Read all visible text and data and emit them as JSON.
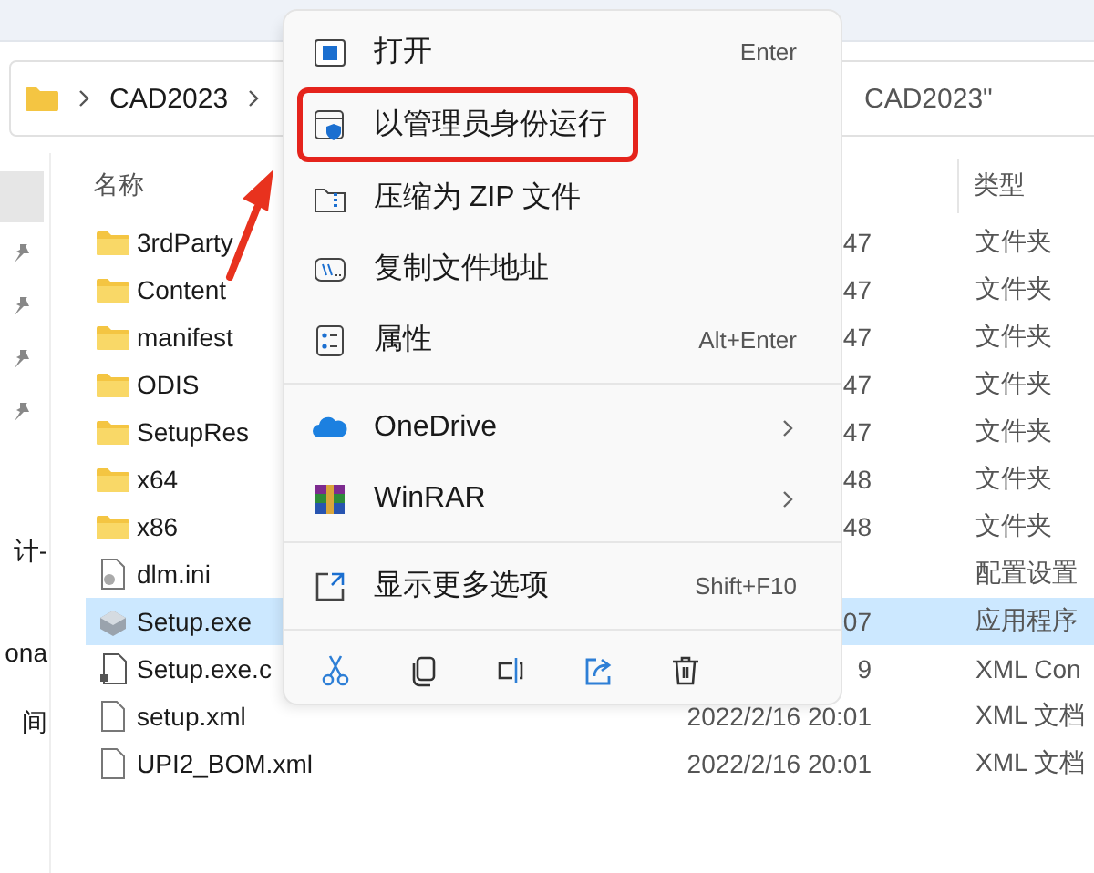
{
  "address_bar": {
    "path": [
      "CAD2023"
    ]
  },
  "search": {
    "value": "CAD2023\""
  },
  "nav_pane": {
    "items": [
      {
        "kind": "entry",
        "selected": true
      },
      {
        "kind": "pinned",
        "selected": false
      },
      {
        "kind": "pinned",
        "selected": false
      },
      {
        "kind": "pinned",
        "selected": false
      },
      {
        "kind": "pinned",
        "selected": false
      },
      {
        "kind": "label",
        "label": "计-",
        "selected": false
      },
      {
        "kind": "label",
        "label": "ona",
        "selected": false
      },
      {
        "kind": "label",
        "label": "间",
        "selected": false
      }
    ]
  },
  "file_list": {
    "columns": [
      "名称",
      "类型"
    ],
    "rows": [
      {
        "kind": "folder",
        "name": "3rdParty",
        "date": "47",
        "type": "文件夹",
        "selected": false
      },
      {
        "kind": "folder",
        "name": "Content",
        "date": "47",
        "type": "文件夹",
        "selected": false
      },
      {
        "kind": "folder",
        "name": "manifest",
        "date": "47",
        "type": "文件夹",
        "selected": false
      },
      {
        "kind": "folder",
        "name": "ODIS",
        "date": "47",
        "type": "文件夹",
        "selected": false
      },
      {
        "kind": "folder",
        "name": "SetupRes",
        "date": "47",
        "type": "文件夹",
        "selected": false
      },
      {
        "kind": "folder",
        "name": "x64",
        "date": "48",
        "type": "文件夹",
        "selected": false
      },
      {
        "kind": "folder",
        "name": "x86",
        "date": "48",
        "type": "文件夹",
        "selected": false
      },
      {
        "kind": "settings",
        "name": "dlm.ini",
        "type": "配置设置",
        "selected": false
      },
      {
        "kind": "installer",
        "name": "Setup.exe",
        "date": "07",
        "type": "应用程序",
        "selected": true
      },
      {
        "kind": "config",
        "name": "Setup.exe.c",
        "date": "9",
        "type": "XML Con",
        "selected": false
      },
      {
        "kind": "document",
        "name": "setup.xml",
        "date": "2022/2/16 20:01",
        "type": "XML 文档",
        "selected": false
      },
      {
        "kind": "document",
        "name": "UPI2_BOM.xml",
        "date": "2022/2/16 20:01",
        "type": "XML 文档",
        "selected": false
      }
    ]
  },
  "context_menu": {
    "items": [
      {
        "kind": "command",
        "label": "打开",
        "shortcut": "Enter",
        "highlighted": false
      },
      {
        "kind": "command",
        "label": "以管理员身份运行",
        "highlighted": true
      },
      {
        "kind": "command",
        "label": "压缩为 ZIP 文件",
        "highlighted": false
      },
      {
        "kind": "command",
        "label": "复制文件地址",
        "highlighted": false
      },
      {
        "kind": "command",
        "label": "属性",
        "shortcut": "Alt+Enter",
        "highlighted": false
      },
      {
        "kind": "separator"
      },
      {
        "kind": "submenu",
        "label": "OneDrive",
        "highlighted": false
      },
      {
        "kind": "submenu",
        "label": "WinRAR",
        "highlighted": false
      },
      {
        "kind": "separator"
      },
      {
        "kind": "command",
        "label": "显示更多选项",
        "shortcut": "Shift+F10",
        "highlighted": false
      },
      {
        "kind": "separator"
      },
      {
        "kind": "toolbar"
      }
    ]
  }
}
